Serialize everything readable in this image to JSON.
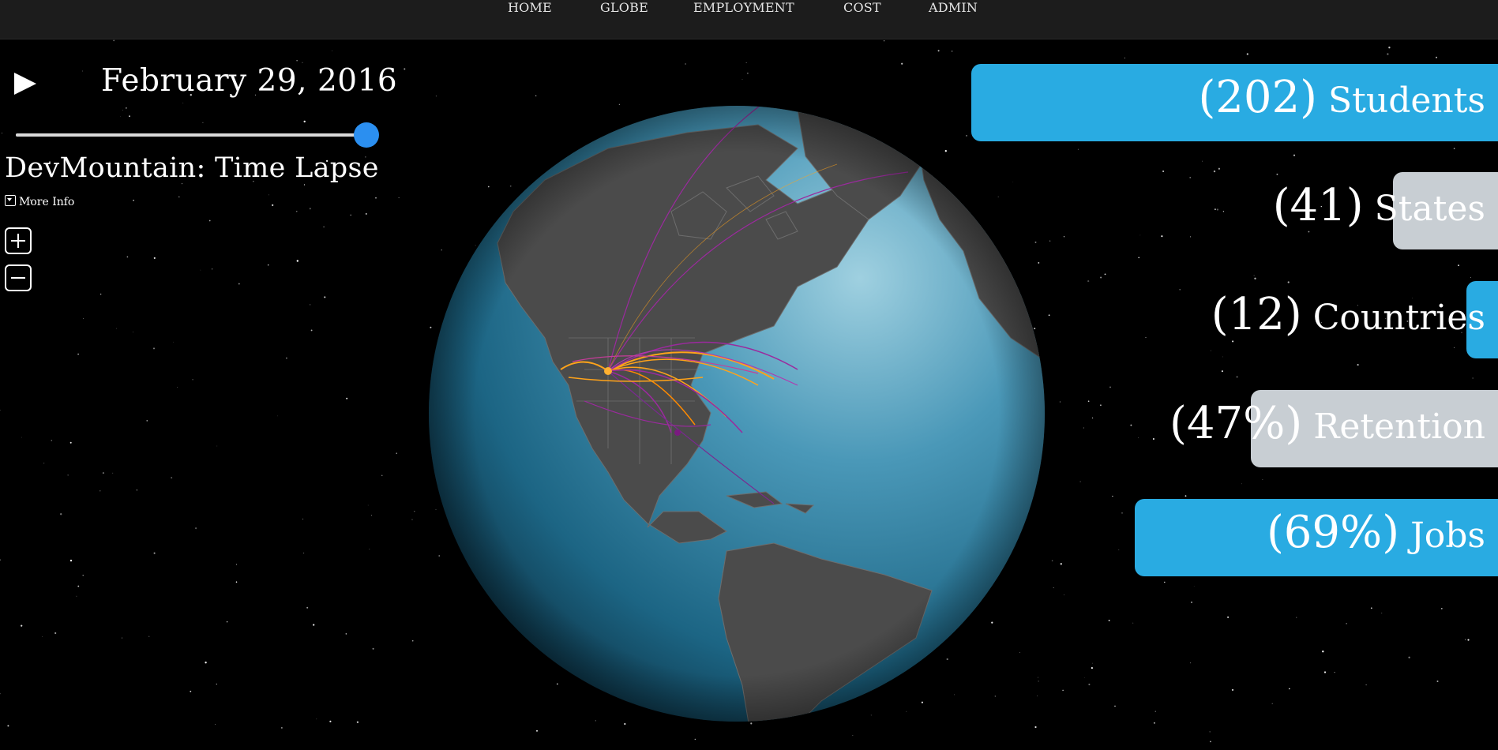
{
  "nav": {
    "items": [
      "HOME",
      "GLOBE",
      "EMPLOYMENT",
      "COST",
      "ADMIN"
    ]
  },
  "timeline": {
    "date": "February 29, 2016",
    "progress": 1.0
  },
  "app": {
    "title": "DevMountain: Time Lapse",
    "more_info": "More Info"
  },
  "stats": [
    {
      "value": "(202)",
      "label": "Students",
      "color": "#29abe2",
      "fill": 1.0
    },
    {
      "value": "(41)",
      "label": "States",
      "color": "#c8ced3",
      "fill": 0.2
    },
    {
      "value": "(12)",
      "label": "Countries",
      "color": "#29abe2",
      "fill": 0.06
    },
    {
      "value": "(47%)",
      "label": "Retention",
      "color": "#c8ced3",
      "fill": 0.47
    },
    {
      "value": "(69%)",
      "label": "Jobs",
      "color": "#29abe2",
      "fill": 0.69
    }
  ],
  "icons": {
    "play": "play-icon",
    "zoom_in": "plus-icon",
    "zoom_out": "minus-icon",
    "more_info": "chevron-down-icon"
  },
  "colors": {
    "accent": "#29abe2",
    "secondary": "#c8ced3",
    "slider": "#2b8ff0",
    "ocean": "#1f6e8f",
    "land": "#4a4a4a",
    "arc_orange": "#ffa31a",
    "arc_purple": "#9b2a9e"
  }
}
